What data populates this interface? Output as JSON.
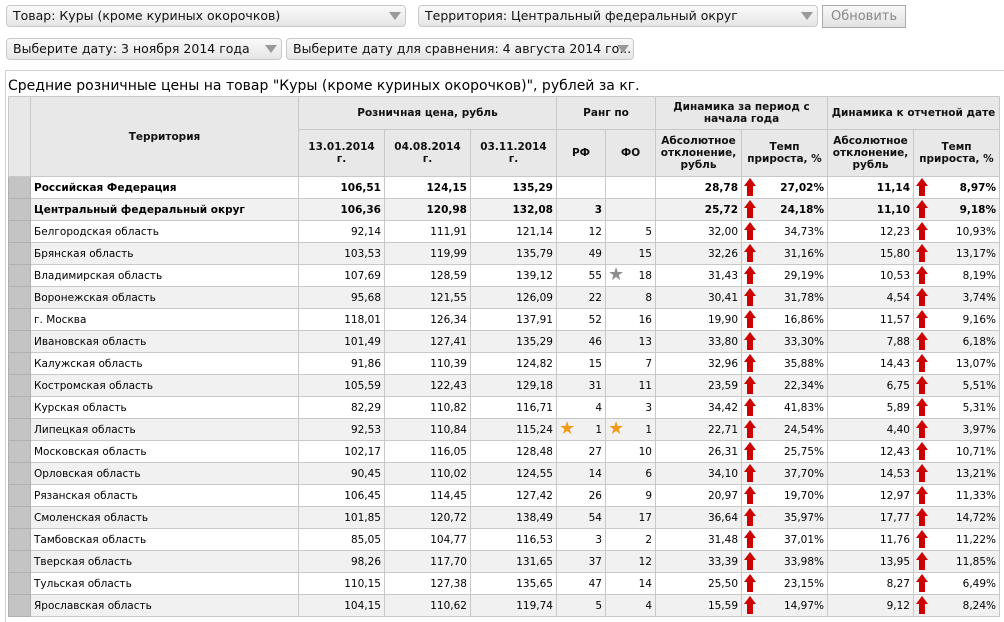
{
  "toolbar": {
    "product_select": "Товар: Куры (кроме куриных окорочков)",
    "territory_select": "Территория: Центральный федеральный округ",
    "refresh_button": "Обновить",
    "date_select": "Выберите дату: 3 ноября 2014 года",
    "compare_date_select": "Выберите дату для сравнения: 4 августа 2014 го..."
  },
  "report": {
    "title": "Средние розничные цены на товар \"Куры (кроме куриных окорочков)\", рублей за кг."
  },
  "table": {
    "headers": {
      "territory": "Территория",
      "price_group": "Розничная цена, рубль",
      "rank_group": "Ранг по",
      "dyn_year_group": "Динамика за период с начала года",
      "dyn_report_group": "Динамика к отчетной дате",
      "date1": "13.01.2014 г.",
      "date2": "04.08.2014 г.",
      "date3": "03.11.2014 г.",
      "rank_rf": "РФ",
      "rank_fo": "ФО",
      "abs_dev": "Абсолютное отклонение, рубль",
      "growth_rate": "Темп прироста, %",
      "abs_dev2": "Абсолютное отклонение, рубль",
      "growth_rate2": "Темп прироста, %"
    },
    "rows": [
      {
        "name": "Российская Федерация",
        "p1": "106,51",
        "p2": "124,15",
        "p3": "135,29",
        "rf": "",
        "fo": "",
        "abs1": "28,78",
        "rate1": "27,02%",
        "abs2": "11,14",
        "rate2": "8,97%",
        "bold": true
      },
      {
        "name": "Центральный федеральный округ",
        "p1": "106,36",
        "p2": "120,98",
        "p3": "132,08",
        "rf": "3",
        "fo": "",
        "abs1": "25,72",
        "rate1": "24,18%",
        "abs2": "11,10",
        "rate2": "9,18%",
        "bold": true
      },
      {
        "name": "Белгородская область",
        "p1": "92,14",
        "p2": "111,91",
        "p3": "121,14",
        "rf": "12",
        "fo": "5",
        "abs1": "32,00",
        "rate1": "34,73%",
        "abs2": "12,23",
        "rate2": "10,93%"
      },
      {
        "name": "Брянская область",
        "p1": "103,53",
        "p2": "119,99",
        "p3": "135,79",
        "rf": "49",
        "fo": "15",
        "abs1": "32,26",
        "rate1": "31,16%",
        "abs2": "15,80",
        "rate2": "13,17%"
      },
      {
        "name": "Владимирская область",
        "p1": "107,69",
        "p2": "128,59",
        "p3": "139,12",
        "rf": "55",
        "fo": "18",
        "abs1": "31,43",
        "rate1": "29,19%",
        "abs2": "10,53",
        "rate2": "8,19%",
        "star_fo": "gray"
      },
      {
        "name": "Воронежская область",
        "p1": "95,68",
        "p2": "121,55",
        "p3": "126,09",
        "rf": "22",
        "fo": "8",
        "abs1": "30,41",
        "rate1": "31,78%",
        "abs2": "4,54",
        "rate2": "3,74%"
      },
      {
        "name": "г. Москва",
        "p1": "118,01",
        "p2": "126,34",
        "p3": "137,91",
        "rf": "52",
        "fo": "16",
        "abs1": "19,90",
        "rate1": "16,86%",
        "abs2": "11,57",
        "rate2": "9,16%"
      },
      {
        "name": "Ивановская область",
        "p1": "101,49",
        "p2": "127,41",
        "p3": "135,29",
        "rf": "46",
        "fo": "13",
        "abs1": "33,80",
        "rate1": "33,30%",
        "abs2": "7,88",
        "rate2": "6,18%"
      },
      {
        "name": "Калужская область",
        "p1": "91,86",
        "p2": "110,39",
        "p3": "124,82",
        "rf": "15",
        "fo": "7",
        "abs1": "32,96",
        "rate1": "35,88%",
        "abs2": "14,43",
        "rate2": "13,07%"
      },
      {
        "name": "Костромская область",
        "p1": "105,59",
        "p2": "122,43",
        "p3": "129,18",
        "rf": "31",
        "fo": "11",
        "abs1": "23,59",
        "rate1": "22,34%",
        "abs2": "6,75",
        "rate2": "5,51%"
      },
      {
        "name": "Курская область",
        "p1": "82,29",
        "p2": "110,82",
        "p3": "116,71",
        "rf": "4",
        "fo": "3",
        "abs1": "34,42",
        "rate1": "41,83%",
        "abs2": "5,89",
        "rate2": "5,31%"
      },
      {
        "name": "Липецкая область",
        "p1": "92,53",
        "p2": "110,84",
        "p3": "115,24",
        "rf": "1",
        "fo": "1",
        "abs1": "22,71",
        "rate1": "24,54%",
        "abs2": "4,40",
        "rate2": "3,97%",
        "star_rf": "gold",
        "star_fo": "gold"
      },
      {
        "name": "Московская область",
        "p1": "102,17",
        "p2": "116,05",
        "p3": "128,48",
        "rf": "27",
        "fo": "10",
        "abs1": "26,31",
        "rate1": "25,75%",
        "abs2": "12,43",
        "rate2": "10,71%"
      },
      {
        "name": "Орловская область",
        "p1": "90,45",
        "p2": "110,02",
        "p3": "124,55",
        "rf": "14",
        "fo": "6",
        "abs1": "34,10",
        "rate1": "37,70%",
        "abs2": "14,53",
        "rate2": "13,21%"
      },
      {
        "name": "Рязанская область",
        "p1": "106,45",
        "p2": "114,45",
        "p3": "127,42",
        "rf": "26",
        "fo": "9",
        "abs1": "20,97",
        "rate1": "19,70%",
        "abs2": "12,97",
        "rate2": "11,33%"
      },
      {
        "name": "Смоленская область",
        "p1": "101,85",
        "p2": "120,72",
        "p3": "138,49",
        "rf": "54",
        "fo": "17",
        "abs1": "36,64",
        "rate1": "35,97%",
        "abs2": "17,77",
        "rate2": "14,72%"
      },
      {
        "name": "Тамбовская область",
        "p1": "85,05",
        "p2": "104,77",
        "p3": "116,53",
        "rf": "3",
        "fo": "2",
        "abs1": "31,48",
        "rate1": "37,01%",
        "abs2": "11,76",
        "rate2": "11,22%"
      },
      {
        "name": "Тверская область",
        "p1": "98,26",
        "p2": "117,70",
        "p3": "131,65",
        "rf": "37",
        "fo": "12",
        "abs1": "33,39",
        "rate1": "33,98%",
        "abs2": "13,95",
        "rate2": "11,85%"
      },
      {
        "name": "Тульская область",
        "p1": "110,15",
        "p2": "127,38",
        "p3": "135,65",
        "rf": "47",
        "fo": "14",
        "abs1": "25,50",
        "rate1": "23,15%",
        "abs2": "8,27",
        "rate2": "6,49%"
      },
      {
        "name": "Ярославская область",
        "p1": "104,15",
        "p2": "110,62",
        "p3": "119,74",
        "rf": "5",
        "fo": "4",
        "abs1": "15,59",
        "rate1": "14,97%",
        "abs2": "9,12",
        "rate2": "8,24%"
      }
    ]
  },
  "icons": {
    "trend": "arrow-up-icon",
    "best": "star-icon",
    "worst": "star-icon"
  },
  "colors": {
    "arrow_up": "#cc0000",
    "star_gold": "#f29a1a",
    "star_gray": "#8d8d8d"
  }
}
